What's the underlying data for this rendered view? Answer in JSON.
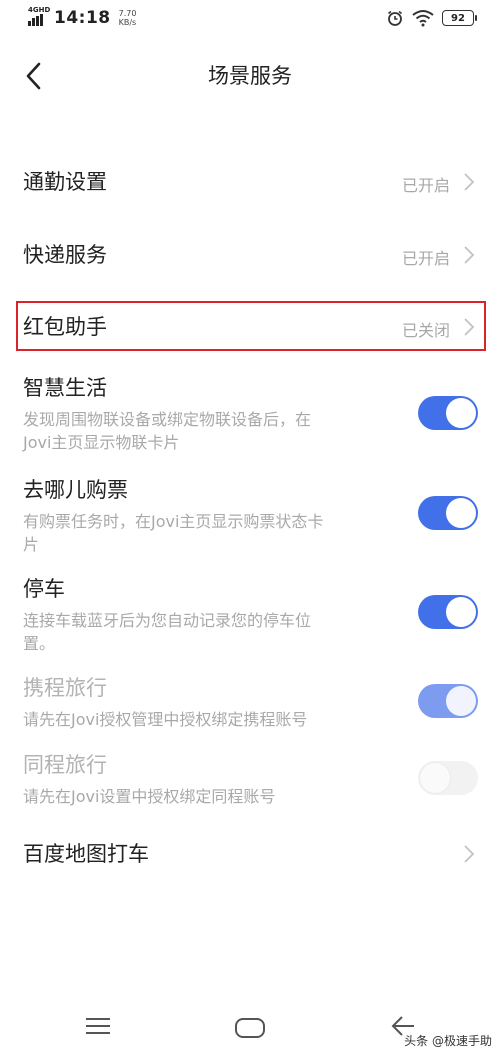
{
  "status_bar": {
    "network": "4GHD",
    "time": "14:18",
    "speed_value": "7.70",
    "speed_unit": "KB/s",
    "battery": "92"
  },
  "header": {
    "title": "场景服务"
  },
  "nav_rows": [
    {
      "title": "通勤设置",
      "status": "已开启"
    },
    {
      "title": "快递服务",
      "status": "已开启"
    },
    {
      "title": "红包助手",
      "status": "已关闭"
    }
  ],
  "toggle_rows": [
    {
      "title": "智慧生活",
      "desc_1": "发现周围物联设备或绑定物联设备后，在",
      "desc_2": "Jovi主页显示物联卡片",
      "state": "on"
    },
    {
      "title": "去哪儿购票",
      "desc_1": "有购票任务时，在Jovi主页显示购票状态卡",
      "desc_2": "片",
      "state": "on"
    },
    {
      "title": "停车",
      "desc_1": "连接车载蓝牙后为您自动记录您的停车位",
      "desc_2": "置。",
      "state": "on"
    },
    {
      "title": "携程旅行",
      "desc_1": "请先在Jovi授权管理中授权绑定携程账号",
      "state": "on-disabled"
    },
    {
      "title": "同程旅行",
      "desc_1": "请先在Jovi设置中授权绑定同程账号",
      "state": "off-disabled"
    }
  ],
  "last_row": {
    "title": "百度地图打车"
  },
  "watermark": "头条 @极速手助",
  "colors": {
    "accent": "#4270e8",
    "highlight_border": "#d9242b"
  }
}
